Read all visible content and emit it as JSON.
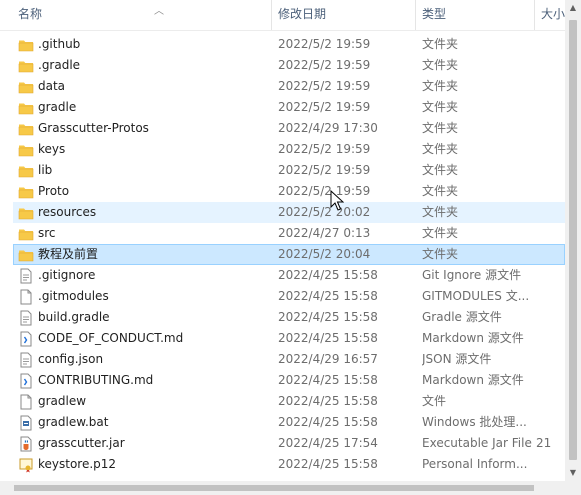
{
  "columns": {
    "name": "名称",
    "date": "修改日期",
    "type": "类型",
    "size": "大小"
  },
  "rows": [
    {
      "name": ".github",
      "date": "2022/5/2 19:59",
      "type": "文件夹",
      "size": "",
      "icon": "folder-icon"
    },
    {
      "name": ".gradle",
      "date": "2022/5/2 19:59",
      "type": "文件夹",
      "size": "",
      "icon": "folder-icon"
    },
    {
      "name": "data",
      "date": "2022/5/2 19:59",
      "type": "文件夹",
      "size": "",
      "icon": "folder-icon"
    },
    {
      "name": "gradle",
      "date": "2022/5/2 19:59",
      "type": "文件夹",
      "size": "",
      "icon": "folder-icon"
    },
    {
      "name": "Grasscutter-Protos",
      "date": "2022/4/29 17:30",
      "type": "文件夹",
      "size": "",
      "icon": "folder-icon"
    },
    {
      "name": "keys",
      "date": "2022/5/2 19:59",
      "type": "文件夹",
      "size": "",
      "icon": "folder-icon"
    },
    {
      "name": "lib",
      "date": "2022/5/2 19:59",
      "type": "文件夹",
      "size": "",
      "icon": "folder-icon"
    },
    {
      "name": "Proto",
      "date": "2022/5/2 19:59",
      "type": "文件夹",
      "size": "",
      "icon": "folder-icon"
    },
    {
      "name": "resources",
      "date": "2022/5/2 20:02",
      "type": "文件夹",
      "size": "",
      "icon": "folder-icon",
      "state": "hover"
    },
    {
      "name": "src",
      "date": "2022/4/27 0:13",
      "type": "文件夹",
      "size": "",
      "icon": "folder-icon"
    },
    {
      "name": "教程及前置",
      "date": "2022/5/2 20:04",
      "type": "文件夹",
      "size": "",
      "icon": "folder-icon",
      "state": "selected"
    },
    {
      "name": ".gitignore",
      "date": "2022/4/25 15:58",
      "type": "Git Ignore 源文件",
      "size": "",
      "icon": "source-file-icon"
    },
    {
      "name": ".gitmodules",
      "date": "2022/4/25 15:58",
      "type": "GITMODULES 文...",
      "size": "",
      "icon": "blank-file-icon"
    },
    {
      "name": "build.gradle",
      "date": "2022/4/25 15:58",
      "type": "Gradle 源文件",
      "size": "",
      "icon": "source-file-icon"
    },
    {
      "name": "CODE_OF_CONDUCT.md",
      "date": "2022/4/25 15:58",
      "type": "Markdown 源文件",
      "size": "",
      "icon": "markdown-file-icon"
    },
    {
      "name": "config.json",
      "date": "2022/4/29 16:57",
      "type": "JSON 源文件",
      "size": "",
      "icon": "source-file-icon"
    },
    {
      "name": "CONTRIBUTING.md",
      "date": "2022/4/25 15:58",
      "type": "Markdown 源文件",
      "size": "",
      "icon": "markdown-file-icon"
    },
    {
      "name": "gradlew",
      "date": "2022/4/25 15:58",
      "type": "文件",
      "size": "",
      "icon": "blank-file-icon"
    },
    {
      "name": "gradlew.bat",
      "date": "2022/4/25 15:58",
      "type": "Windows 批处理...",
      "size": "",
      "icon": "batch-file-icon"
    },
    {
      "name": "grasscutter.jar",
      "date": "2022/4/25 17:54",
      "type": "Executable Jar File",
      "size": "21",
      "icon": "jar-file-icon"
    },
    {
      "name": "keystore.p12",
      "date": "2022/4/25 15:58",
      "type": "Personal Inform...",
      "size": "",
      "icon": "certificate-file-icon"
    }
  ],
  "colors": {
    "folder": "#f7c948",
    "folder_dark": "#e0a82e",
    "hover": "#e5f3ff",
    "selected": "#cce8ff",
    "selected_border": "#99d1ff",
    "header_text": "#4c607a"
  }
}
